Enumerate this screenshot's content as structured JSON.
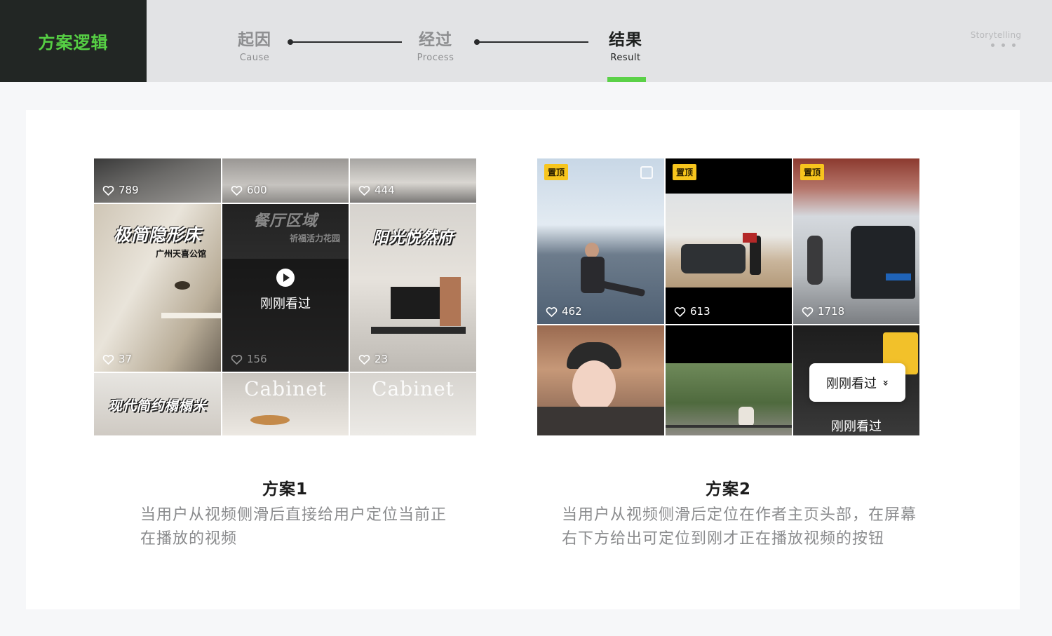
{
  "brand": {
    "title": "方案逻辑"
  },
  "steps": [
    {
      "cn": "起因",
      "en": "Cause",
      "active": false
    },
    {
      "cn": "经过",
      "en": "Process",
      "active": false
    },
    {
      "cn": "结果",
      "en": "Result",
      "active": true
    }
  ],
  "corner": {
    "label": "Storytelling"
  },
  "scheme1": {
    "title": "方案1",
    "description": "当用户从视频侧滑后直接给用户定位当前正在播放的视频",
    "tiles": [
      {
        "likes": "789"
      },
      {
        "likes": "600"
      },
      {
        "likes": "444"
      },
      {
        "likes": "37",
        "overlay": "极简隐形床",
        "subtitle": "广州天喜公馆"
      },
      {
        "likes": "156",
        "overlay": "餐厅区域",
        "subtitle": "祈福活力花园",
        "watched": "刚刚看过"
      },
      {
        "likes": "23",
        "overlay": "阳光悦然府"
      },
      {
        "overlay": "现代简约榻榻米"
      },
      {
        "overlay": "Cabinet"
      },
      {
        "overlay": "Cabinet"
      }
    ]
  },
  "scheme2": {
    "title": "方案2",
    "description": "当用户从视频侧滑后定位在作者主页头部，在屏幕右下方给出可定位到刚才正在播放视频的按钮",
    "pin_label": "置顶",
    "tiles": [
      {
        "likes": "462"
      },
      {
        "likes": "613"
      },
      {
        "likes": "1718"
      },
      {},
      {},
      {
        "watched": "刚刚看过"
      }
    ],
    "float_button": {
      "label": "刚刚看过",
      "icon": "double-chevron-down-icon"
    }
  },
  "colors": {
    "accent": "#5bd148",
    "pin": "#f7c51d",
    "brand_bg": "#222624"
  }
}
